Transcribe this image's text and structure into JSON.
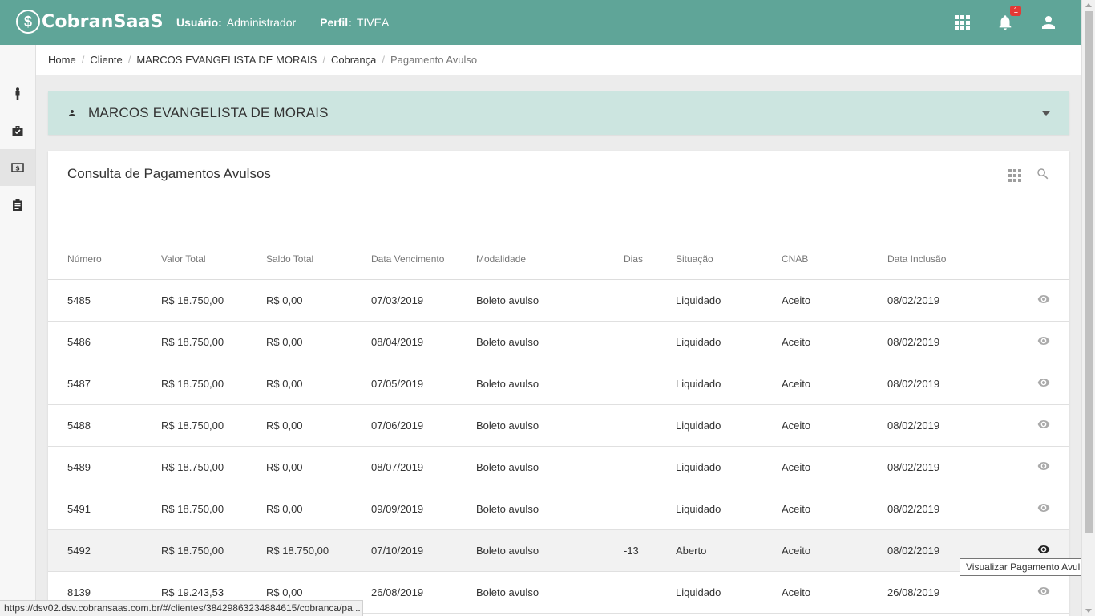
{
  "app": {
    "logo_text": "CobranSaaS",
    "logo_mark": "$",
    "user_label": "Usuário:",
    "user_value": "Administrador",
    "profile_label": "Perfil:",
    "profile_value": "TIVEA",
    "notification_count": "1",
    "brand_color": "#5fa598"
  },
  "breadcrumb": [
    "Home",
    "Cliente",
    "MARCOS EVANGELISTA DE MORAIS",
    "Cobrança",
    "Pagamento Avulso"
  ],
  "left_rail": {
    "items": [
      "person-icon",
      "briefcase-check-icon",
      "money-icon",
      "clipboard-icon"
    ],
    "active_index": 2
  },
  "client_panel": {
    "name": "MARCOS EVANGELISTA DE MORAIS",
    "icon": "person-icon",
    "panel_color": "#cce5e0"
  },
  "card": {
    "title": "Consulta de Pagamentos Avulsos",
    "tools": [
      "grid-icon",
      "search-icon"
    ]
  },
  "table": {
    "columns": [
      "Número",
      "Valor Total",
      "Saldo Total",
      "Data Vencimento",
      "Modalidade",
      "Dias",
      "Situação",
      "CNAB",
      "Data Inclusão"
    ],
    "rows": [
      {
        "numero": "5485",
        "valor": "R$ 18.750,00",
        "saldo": "R$ 0,00",
        "vencimento": "07/03/2019",
        "modalidade": "Boleto avulso",
        "dias": "",
        "situacao": "Liquidado",
        "cnab": "Aceito",
        "inclusao": "08/02/2019"
      },
      {
        "numero": "5486",
        "valor": "R$ 18.750,00",
        "saldo": "R$ 0,00",
        "vencimento": "08/04/2019",
        "modalidade": "Boleto avulso",
        "dias": "",
        "situacao": "Liquidado",
        "cnab": "Aceito",
        "inclusao": "08/02/2019"
      },
      {
        "numero": "5487",
        "valor": "R$ 18.750,00",
        "saldo": "R$ 0,00",
        "vencimento": "07/05/2019",
        "modalidade": "Boleto avulso",
        "dias": "",
        "situacao": "Liquidado",
        "cnab": "Aceito",
        "inclusao": "08/02/2019"
      },
      {
        "numero": "5488",
        "valor": "R$ 18.750,00",
        "saldo": "R$ 0,00",
        "vencimento": "07/06/2019",
        "modalidade": "Boleto avulso",
        "dias": "",
        "situacao": "Liquidado",
        "cnab": "Aceito",
        "inclusao": "08/02/2019"
      },
      {
        "numero": "5489",
        "valor": "R$ 18.750,00",
        "saldo": "R$ 0,00",
        "vencimento": "08/07/2019",
        "modalidade": "Boleto avulso",
        "dias": "",
        "situacao": "Liquidado",
        "cnab": "Aceito",
        "inclusao": "08/02/2019"
      },
      {
        "numero": "5491",
        "valor": "R$ 18.750,00",
        "saldo": "R$ 0,00",
        "vencimento": "09/09/2019",
        "modalidade": "Boleto avulso",
        "dias": "",
        "situacao": "Liquidado",
        "cnab": "Aceito",
        "inclusao": "08/02/2019"
      },
      {
        "numero": "5492",
        "valor": "R$ 18.750,00",
        "saldo": "R$ 18.750,00",
        "vencimento": "07/10/2019",
        "modalidade": "Boleto avulso",
        "dias": "-13",
        "situacao": "Aberto",
        "cnab": "Aceito",
        "inclusao": "08/02/2019"
      },
      {
        "numero": "8139",
        "valor": "R$ 19.243,53",
        "saldo": "R$ 0,00",
        "vencimento": "26/08/2019",
        "modalidade": "Boleto avulso",
        "dias": "",
        "situacao": "Liquidado",
        "cnab": "Aceito",
        "inclusao": "26/08/2019"
      }
    ],
    "hovered_row": 6,
    "row_action_icon": "eye-icon"
  },
  "tooltip": "Visualizar Pagamento Avulso",
  "status_url": "https://dsv02.dsv.cobransaas.com.br/#/clientes/38429863234884615/cobranca/pa..."
}
